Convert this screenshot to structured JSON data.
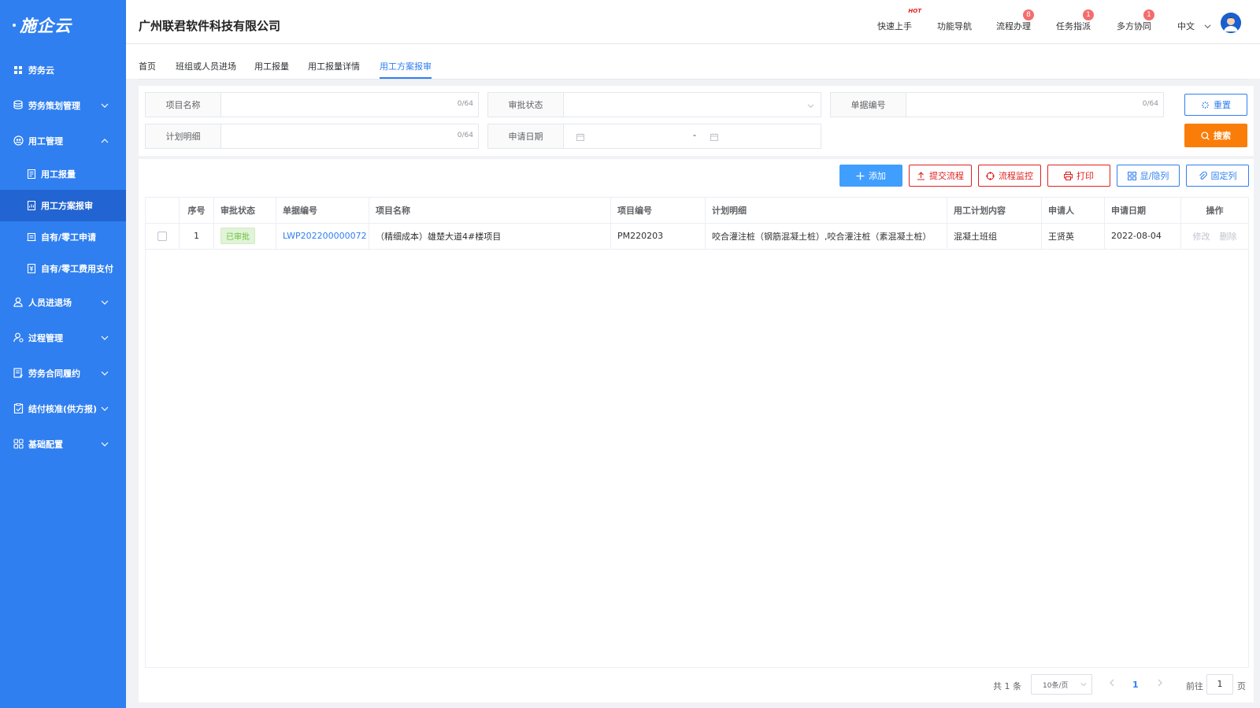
{
  "sidebar": {
    "logo": "施企云",
    "items": [
      {
        "label": "劳务云",
        "icon": "grid-icon"
      },
      {
        "label": "劳务策划管理",
        "icon": "database-icon"
      },
      {
        "label": "用工管理",
        "icon": "users-circle-icon"
      },
      {
        "label": "人员进退场",
        "icon": "user-icon"
      },
      {
        "label": "过程管理",
        "icon": "user-gear-icon"
      },
      {
        "label": "劳务合同履约",
        "icon": "contract-icon"
      },
      {
        "label": "结付核准(供方报)",
        "icon": "clipboard-check-icon"
      },
      {
        "label": "基础配置",
        "icon": "apps-icon"
      }
    ],
    "sub_items": [
      {
        "label": "用工报量"
      },
      {
        "label": "用工方案报审"
      },
      {
        "label": "自有/零工申请"
      },
      {
        "label": "自有/零工费用支付"
      }
    ]
  },
  "header": {
    "company": "广州联君软件科技有限公司",
    "links": [
      {
        "label": "快速上手",
        "hot": "HOT"
      },
      {
        "label": "功能导航"
      },
      {
        "label": "流程办理",
        "badge": "8"
      },
      {
        "label": "任务指派",
        "badge": "1"
      },
      {
        "label": "多方协同",
        "badge": "1"
      }
    ],
    "language": "中文"
  },
  "tabs": [
    "首页",
    "班组或人员进场",
    "用工报量",
    "用工报量详情",
    "用工方案报审"
  ],
  "filters": {
    "project_name": {
      "label": "项目名称",
      "count": "0/64"
    },
    "approval_status": {
      "label": "审批状态"
    },
    "doc_no": {
      "label": "单据编号",
      "count": "0/64"
    },
    "plan_detail": {
      "label": "计划明细",
      "count": "0/64"
    },
    "apply_date": {
      "label": "申请日期",
      "sep": "-"
    },
    "reset_label": "重置",
    "search_label": "搜索"
  },
  "toolbar": {
    "add": "添加",
    "submit_flow": "提交流程",
    "monitor_flow": "流程监控",
    "print": "打印",
    "toggle_cols": "显/隐列",
    "fix_cols": "固定列"
  },
  "table": {
    "headers": [
      "序号",
      "审批状态",
      "单据编号",
      "项目名称",
      "项目编号",
      "计划明细",
      "用工计划内容",
      "申请人",
      "申请日期",
      "操作"
    ],
    "rows": [
      {
        "index": "1",
        "status": "已审批",
        "doc_no": "LWP202200000072",
        "project_name": "（精细成本）雄楚大道4#楼项目",
        "project_no": "PM220203",
        "plan_detail": "咬合灌注桩（钢筋混凝土桩）,咬合灌注桩（素混凝土桩）",
        "plan_content": "混凝土班组",
        "applicant": "王贤英",
        "apply_date": "2022-08-04",
        "edit": "修改",
        "delete": "删除"
      }
    ]
  },
  "pagination": {
    "total": "共 1 条",
    "page_size": "10条/页",
    "current": "1",
    "goto_label": "前往",
    "goto_value": "1",
    "page_label": "页"
  }
}
